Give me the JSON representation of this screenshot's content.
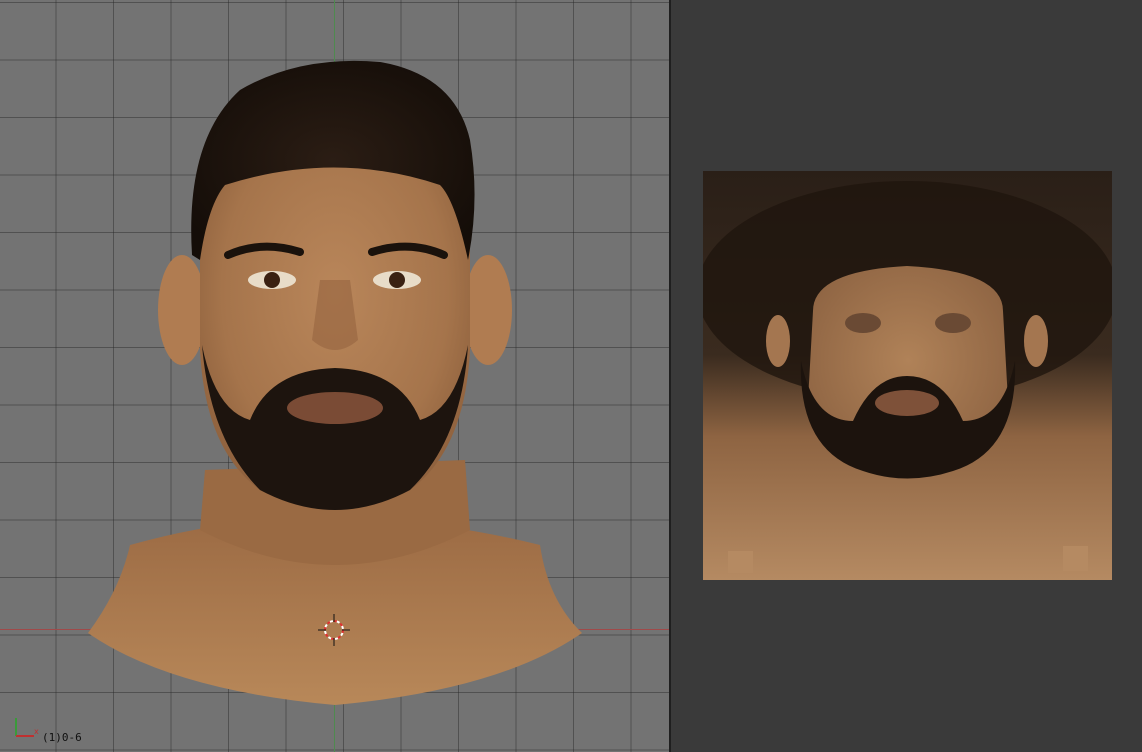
{
  "viewport_3d": {
    "frame_label": "(1)0-6",
    "icons": [
      "axis-icon",
      "3d-cursor-icon"
    ],
    "colors": {
      "background": "#737373",
      "grid_line": "#5e5e5e",
      "x_axis": "#a04a4a",
      "y_axis": "#4f8a4f"
    }
  },
  "uv_image_editor": {
    "colors": {
      "background": "#3a3a3a"
    }
  }
}
